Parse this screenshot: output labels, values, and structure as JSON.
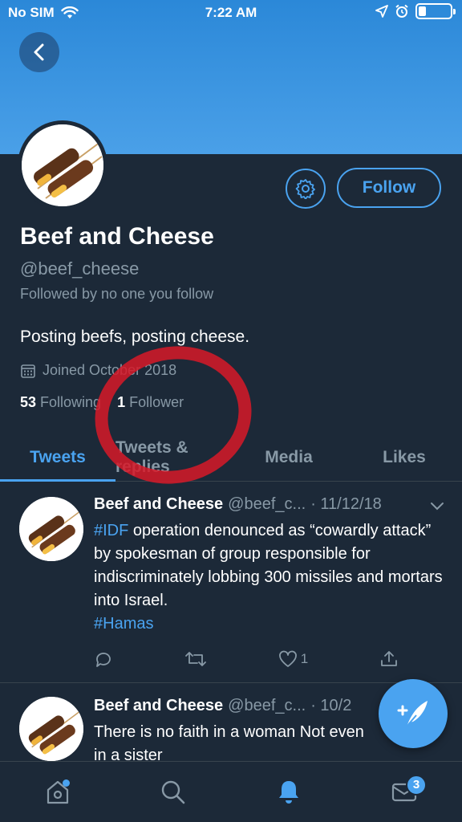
{
  "status_bar": {
    "carrier": "No SIM",
    "time": "7:22 AM"
  },
  "profile": {
    "name": "Beef and Cheese",
    "handle": "@beef_cheese",
    "followed_by": "Followed by no one you follow",
    "bio": "Posting beefs, posting cheese.",
    "joined": "Joined October 2018",
    "following_count": "53",
    "following_label": "Following",
    "followers_count": "1",
    "followers_label": "Follower",
    "follow_button": "Follow"
  },
  "tabs": [
    "Tweets",
    "Tweets & replies",
    "Media",
    "Likes"
  ],
  "tweets": [
    {
      "name": "Beef and Cheese",
      "handle": "@beef_c...",
      "date": "· 11/12/18",
      "hashtag1": "#IDF",
      "text": " operation denounced as “cowardly attack” by spokesman of group responsible for indiscriminately lobbing 300 missiles and mortars into Israel.",
      "hashtag2": "#Hamas",
      "likes": "1"
    },
    {
      "name": "Beef and Cheese",
      "handle": "@beef_c...",
      "date": "· 10/2",
      "text": "There is no faith in a woman Not even in a sister"
    }
  ],
  "tabbar": {
    "messages_badge": "3"
  },
  "colors": {
    "accent": "#4aa3f0",
    "background": "#1c2938",
    "muted": "#8899a6",
    "annotation": "#d71928"
  }
}
